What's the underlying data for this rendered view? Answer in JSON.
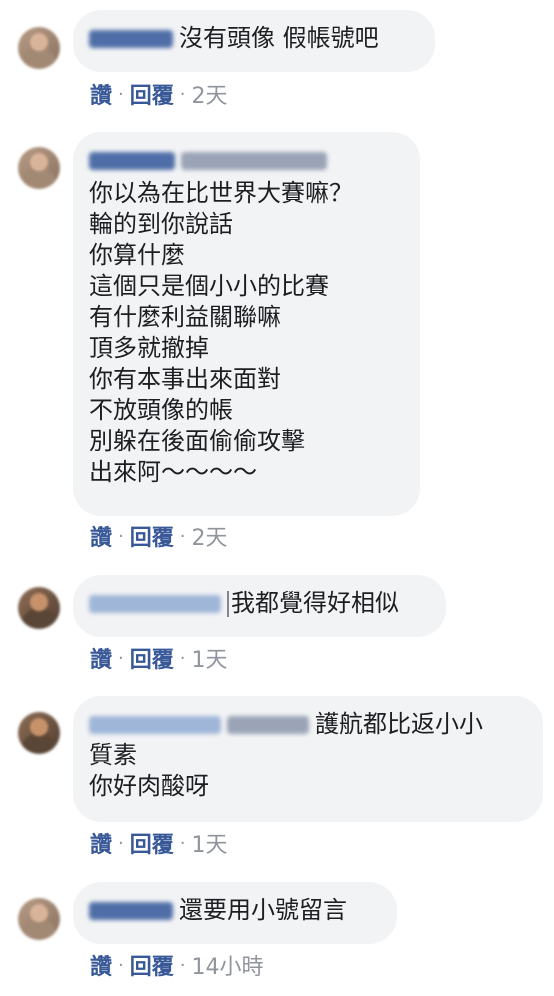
{
  "comments": [
    {
      "text_lines": [
        "沒有頭像 假帳號吧"
      ],
      "actions": {
        "like": "讚",
        "reply": "回覆",
        "time": "2天",
        "sep": "·"
      }
    },
    {
      "text_lines": [
        "你以為在比世界大賽嘛？",
        "輪的到你說話",
        "你算什麼",
        "這個只是個小小的比賽",
        "有什麼利益關聯嘛",
        "頂多就撤掉",
        "你有本事出來面對",
        "不放頭像的帳",
        "別躲在後面偷偷攻擊",
        "出來阿～～～～"
      ],
      "actions": {
        "like": "讚",
        "reply": "回覆",
        "time": "2天",
        "sep": "·"
      }
    },
    {
      "text_lines": [
        "我都覺得好相似"
      ],
      "actions": {
        "like": "讚",
        "reply": "回覆",
        "time": "1天",
        "sep": "·"
      }
    },
    {
      "text_lines": [
        "護航都比返小小",
        "質素",
        "你好肉酸呀"
      ],
      "actions": {
        "like": "讚",
        "reply": "回覆",
        "time": "1天",
        "sep": "·"
      }
    },
    {
      "text_lines": [
        "還要用小號留言"
      ],
      "actions": {
        "like": "讚",
        "reply": "回覆",
        "time": "14小時",
        "sep": "·"
      }
    }
  ]
}
